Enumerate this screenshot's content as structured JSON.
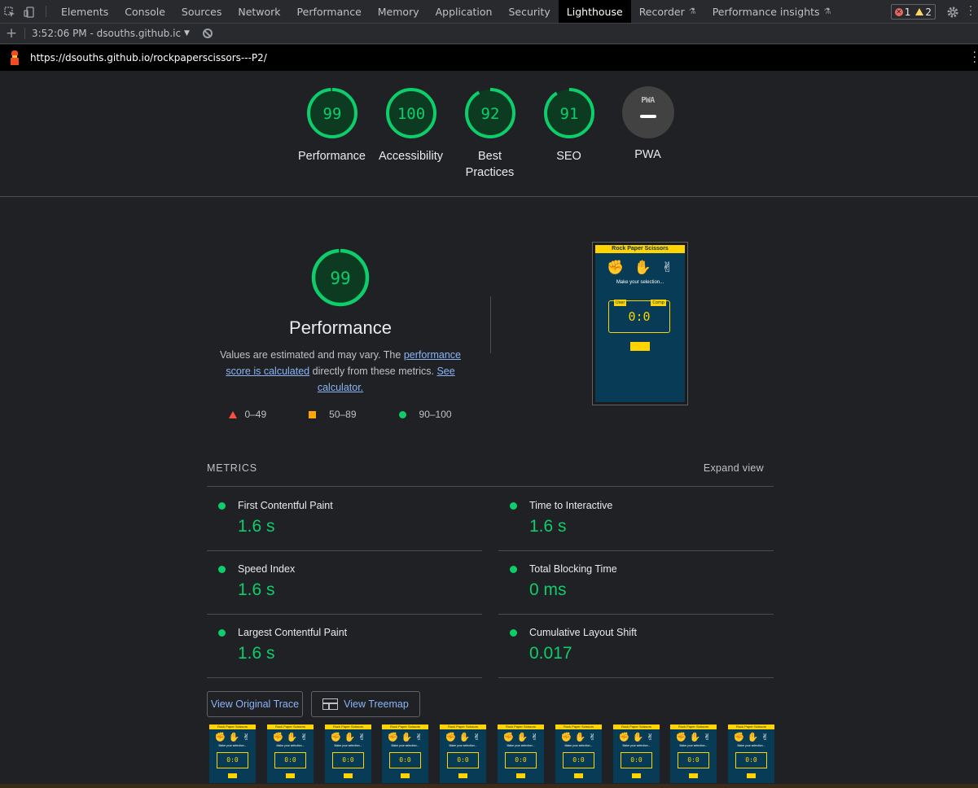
{
  "tabbar": {
    "tabs": [
      "Elements",
      "Console",
      "Sources",
      "Network",
      "Performance",
      "Memory",
      "Application",
      "Security",
      "Lighthouse",
      "Recorder",
      "Performance insights"
    ],
    "active": "Lighthouse",
    "error_count": "1",
    "warning_count": "2"
  },
  "toolbar": {
    "report_label": "3:52:06 PM - dsouths.github.ic"
  },
  "urlbar": {
    "url": "https://dsouths.github.io/rockpaperscissors---P2/"
  },
  "gauges": [
    {
      "score": "99",
      "label": "Performance"
    },
    {
      "score": "100",
      "label": "Accessibility"
    },
    {
      "score": "92",
      "label": "Best Practices"
    },
    {
      "score": "91",
      "label": "SEO"
    },
    {
      "score": "",
      "label": "PWA"
    }
  ],
  "pwa_badge_text": "PWA",
  "performance": {
    "score": "99",
    "title": "Performance",
    "desc_pre": "Values are estimated and may vary. The ",
    "desc_link1": "performance score is calculated",
    "desc_mid": " directly from these metrics. ",
    "desc_link2": "See calculator.",
    "legend": {
      "fail": "0–49",
      "average": "50–89",
      "pass": "90–100"
    },
    "colors": {
      "pass": "#0cce6b",
      "average": "#ffa400",
      "fail": "#ff4e42"
    }
  },
  "screenshot": {
    "header": "Rock Paper Scissors",
    "hands": [
      "✊",
      "✋",
      "✌"
    ],
    "selection_text": "Make your selection...",
    "user_tag": "User",
    "comp_tag": "Comp",
    "score": "0:0"
  },
  "metrics": {
    "title": "METRICS",
    "expand": "Expand view",
    "items": [
      {
        "name": "First Contentful Paint",
        "value": "1.6 s"
      },
      {
        "name": "Time to Interactive",
        "value": "1.6 s"
      },
      {
        "name": "Speed Index",
        "value": "1.6 s"
      },
      {
        "name": "Total Blocking Time",
        "value": "0 ms"
      },
      {
        "name": "Largest Contentful Paint",
        "value": "1.6 s"
      },
      {
        "name": "Cumulative Layout Shift",
        "value": "0.017"
      }
    ]
  },
  "buttons": {
    "trace": "View Original Trace",
    "treemap": "View Treemap"
  },
  "filmstrip": {
    "frame_header": "Rock Paper Scissors",
    "frame_score": "0:0",
    "frame_count": 10
  }
}
